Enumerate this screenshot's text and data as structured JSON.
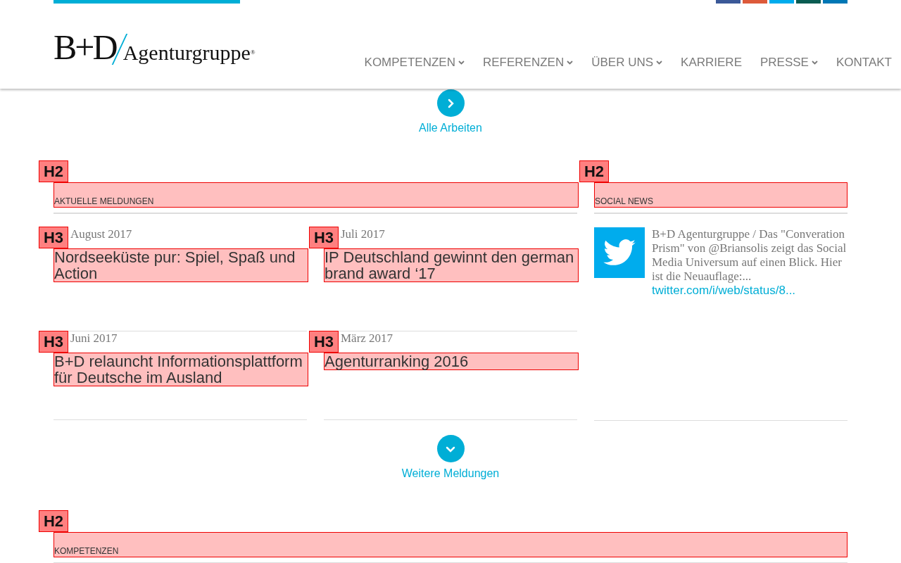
{
  "social_links": [
    {
      "color": "#3b5998"
    },
    {
      "color": "#dd5a3a"
    },
    {
      "color": "#00aced"
    },
    {
      "color": "#0a5c52"
    },
    {
      "color": "#0077b5"
    }
  ],
  "header": {
    "logo": {
      "mark": "B+D",
      "name": "Agenturgruppe",
      "registered": "®"
    },
    "nav": [
      {
        "label": "KOMPETENZEN",
        "has_dropdown": true
      },
      {
        "label": "REFERENZEN",
        "has_dropdown": true
      },
      {
        "label": "ÜBER UNS",
        "has_dropdown": true
      },
      {
        "label": "KARRIERE",
        "has_dropdown": false
      },
      {
        "label": "PRESSE",
        "has_dropdown": true
      },
      {
        "label": "KONTAKT",
        "has_dropdown": false
      }
    ]
  },
  "works_link": {
    "label": "Alle Arbeiten"
  },
  "news": {
    "heading": {
      "tag": "H2",
      "text": "AKTUELLE MELDUNGEN"
    },
    "items": [
      {
        "tag": "H3",
        "date": "August 2017",
        "title": "Nordseeküste pur: Spiel, Spaß und Action"
      },
      {
        "tag": "H3",
        "date": "Juli 2017",
        "title": "IP Deutschland gewinnt den german brand award ‘17"
      },
      {
        "tag": "H3",
        "date": "Juni 2017",
        "title": "B+D relauncht Informationsplattform für Deutsche im Ausland"
      },
      {
        "tag": "H3",
        "date": "März 2017",
        "title": "Agenturranking 2016"
      }
    ]
  },
  "social": {
    "heading": {
      "tag": "H2",
      "text": "SOCIAL NEWS"
    },
    "tweet": {
      "text": "B+D Agenturgruppe / Das \"Converation Prism\" von @Briansolis zeigt das Social Media Universum auf einen Blick. Hier ist die Neuauflage:...",
      "link": "twitter.com/i/web/status/8..."
    }
  },
  "more_link": {
    "label": "Weitere Meldungen"
  },
  "competences": {
    "heading": {
      "tag": "H2",
      "text": "KOMPETENZEN"
    }
  }
}
